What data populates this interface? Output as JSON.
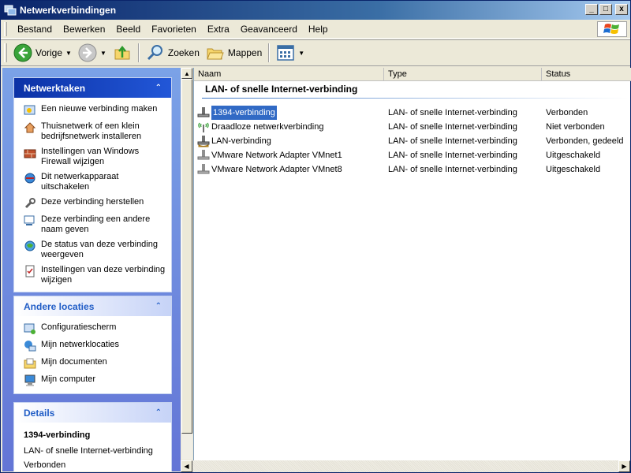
{
  "window": {
    "title": "Netwerkverbindingen",
    "caption_buttons": [
      "_",
      "□",
      "x"
    ]
  },
  "menu": {
    "items": [
      "Bestand",
      "Bewerken",
      "Beeld",
      "Favorieten",
      "Extra",
      "Geavanceerd",
      "Help"
    ]
  },
  "toolbar": {
    "back_label": "Vorige",
    "search_label": "Zoeken",
    "folders_label": "Mappen"
  },
  "taskpane": {
    "network_tasks": {
      "title": "Netwerktaken",
      "items": [
        {
          "label": "Een nieuwe verbinding maken",
          "icon": "new-connection-icon"
        },
        {
          "label": "Thuisnetwerk of een klein bedrijfsnetwerk installeren",
          "icon": "home-network-icon"
        },
        {
          "label": "Instellingen van Windows Firewall wijzigen",
          "icon": "firewall-icon"
        },
        {
          "label": "Dit netwerkapparaat uitschakelen",
          "icon": "disable-device-icon"
        },
        {
          "label": "Deze verbinding herstellen",
          "icon": "repair-icon"
        },
        {
          "label": "Deze verbinding een andere naam geven",
          "icon": "rename-icon"
        },
        {
          "label": "De status van deze verbinding weergeven",
          "icon": "status-icon"
        },
        {
          "label": "Instellingen van deze verbinding wijzigen",
          "icon": "settings-icon"
        }
      ]
    },
    "other_places": {
      "title": "Andere locaties",
      "items": [
        {
          "label": "Configuratiescherm",
          "icon": "control-panel-icon"
        },
        {
          "label": "Mijn netwerklocaties",
          "icon": "network-places-icon"
        },
        {
          "label": "Mijn documenten",
          "icon": "my-documents-icon"
        },
        {
          "label": "Mijn computer",
          "icon": "my-computer-icon"
        }
      ]
    },
    "details": {
      "title": "Details",
      "name": "1394-verbinding",
      "type": "LAN- of snelle Internet-verbinding",
      "status": "Verbonden"
    }
  },
  "listview": {
    "columns": [
      "Naam",
      "Type",
      "Status"
    ],
    "group_title": "LAN- of snelle Internet-verbinding",
    "rows": [
      {
        "name": "1394-verbinding",
        "type": "LAN- of snelle Internet-verbinding",
        "status": "Verbonden",
        "icon": "network-cable-icon",
        "selected": true
      },
      {
        "name": "Draadloze netwerkverbinding",
        "type": "LAN- of snelle Internet-verbinding",
        "status": "Niet verbonden",
        "icon": "wireless-network-icon",
        "selected": false
      },
      {
        "name": "LAN-verbinding",
        "type": "LAN- of snelle Internet-verbinding",
        "status": "Verbonden, gedeeld",
        "icon": "shared-network-icon",
        "selected": false
      },
      {
        "name": "VMware Network Adapter VMnet1",
        "type": "LAN- of snelle Internet-verbinding",
        "status": "Uitgeschakeld",
        "icon": "disabled-network-icon",
        "selected": false
      },
      {
        "name": "VMware Network Adapter VMnet8",
        "type": "LAN- of snelle Internet-verbinding",
        "status": "Uitgeschakeld",
        "icon": "disabled-network-icon",
        "selected": false
      }
    ]
  },
  "colors": {
    "title_bar": "#0a246a",
    "selection": "#316ac5",
    "taskpane_header": "#0c32a6",
    "link_blue": "#215dc6"
  }
}
